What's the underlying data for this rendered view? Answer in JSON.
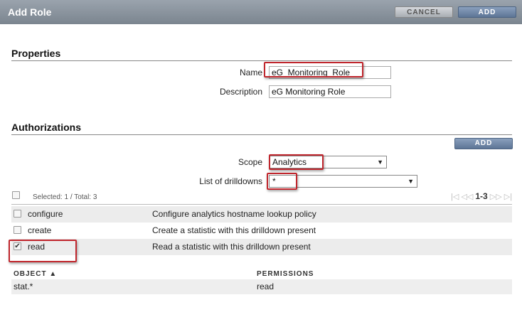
{
  "dialog": {
    "title": "Add Role",
    "cancel_label": "CANCEL",
    "add_label": "ADD"
  },
  "properties": {
    "heading": "Properties",
    "name_label": "Name",
    "name_value": "eG  Monitoring  Role",
    "description_label": "Description",
    "description_value": "eG Monitoring Role"
  },
  "authorizations": {
    "heading": "Authorizations",
    "add_label": "ADD",
    "scope_label": "Scope",
    "scope_value": "Analytics",
    "drilldowns_label": "List of drilldowns",
    "drilldowns_value": "*",
    "selected_text": "Selected: 1 / Total: 3",
    "pager_range": "1-3",
    "rows": [
      {
        "name": "configure",
        "description": "Configure analytics hostname lookup policy",
        "checked": false
      },
      {
        "name": "create",
        "description": "Create a statistic with this drilldown present",
        "checked": false
      },
      {
        "name": "read",
        "description": "Read a statistic with this drilldown present",
        "checked": true
      }
    ],
    "table": {
      "object_header": "OBJECT ▲",
      "permissions_header": "PERMISSIONS",
      "object_value": "stat.*",
      "permissions_value": "read"
    }
  },
  "colors": {
    "titlebar": "#8a939d",
    "accent_button": "#6b82a2",
    "highlight": "#c0262d"
  }
}
